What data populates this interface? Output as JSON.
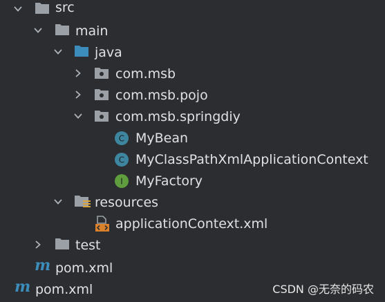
{
  "tree": {
    "src": "src",
    "main": "main",
    "java": "java",
    "pkg_msb": "com.msb",
    "pkg_pojo": "com.msb.pojo",
    "pkg_springdiy": "com.msb.springdiy",
    "class_mybean": "MyBean",
    "class_context": "MyClassPathXmlApplicationContext",
    "iface_factory": "MyFactory",
    "resources": "resources",
    "xml_appctx": "applicationContext.xml",
    "test": "test",
    "pom_inner": "pom.xml",
    "pom_outer": "pom.xml"
  },
  "icon_letters": {
    "class": "C",
    "interface": "I",
    "maven": "m"
  },
  "watermark": "CSDN @无奈的码农",
  "colors": {
    "background": "#2b2d30",
    "text": "#dfe1e5",
    "chevron": "#aeb3bb",
    "folder_grey": "#9aa0a6",
    "folder_blue": "#3d8dbc",
    "class_icon": "#3e86a0",
    "interface_icon": "#5f9d3f",
    "maven_blue": "#3d8dbc",
    "xml_orange": "#d9822b"
  }
}
